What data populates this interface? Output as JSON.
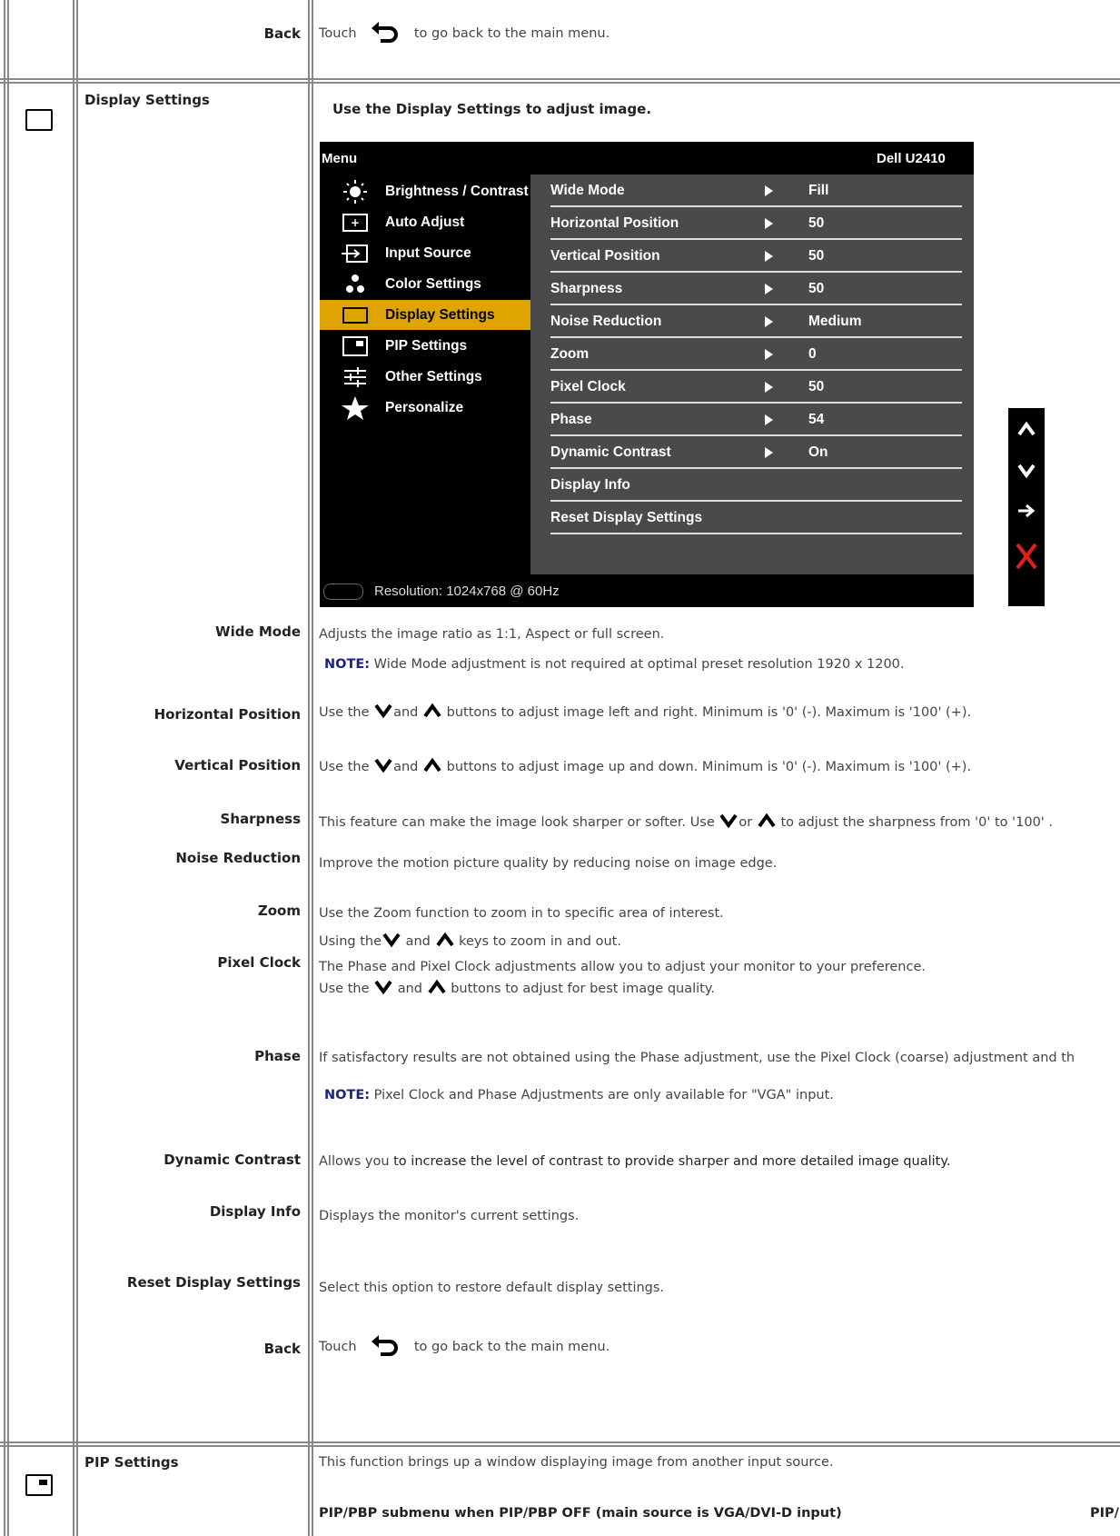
{
  "top": {
    "back_label": "Back",
    "back_pre": "Touch",
    "back_post": "to go back to the main menu."
  },
  "display": {
    "title": "Display Settings",
    "intro": "Use the Display Settings to adjust image.",
    "osd": {
      "menu_title": "Menu",
      "model": "Dell U2410",
      "main_items": [
        {
          "label": "Brightness / Contrast",
          "icon": "brightness-icon"
        },
        {
          "label": "Auto Adjust",
          "icon": "auto-adjust-icon"
        },
        {
          "label": "Input Source",
          "icon": "input-source-icon"
        },
        {
          "label": "Color Settings",
          "icon": "color-settings-icon"
        },
        {
          "label": "Display Settings",
          "icon": "display-settings-icon"
        },
        {
          "label": "PIP Settings",
          "icon": "pip-settings-icon"
        },
        {
          "label": "Other Settings",
          "icon": "other-settings-icon"
        },
        {
          "label": "Personalize",
          "icon": "star-icon"
        }
      ],
      "active_index": 4,
      "sub_items": [
        {
          "name": "Wide Mode",
          "value": "Fill"
        },
        {
          "name": "Horizontal Position",
          "value": "50"
        },
        {
          "name": "Vertical Position",
          "value": "50"
        },
        {
          "name": "Sharpness",
          "value": "50"
        },
        {
          "name": "Noise Reduction",
          "value": "Medium"
        },
        {
          "name": "Zoom",
          "value": "0"
        },
        {
          "name": "Pixel Clock",
          "value": "50"
        },
        {
          "name": "Phase",
          "value": "54"
        },
        {
          "name": "Dynamic Contrast",
          "value": "On"
        },
        {
          "name": "Display Info",
          "value": ""
        },
        {
          "name": "Reset Display Settings",
          "value": ""
        }
      ],
      "resolution": "Resolution: 1024x768 @ 60Hz",
      "accent_color": "#e0a400",
      "nav_icons": [
        "up-arrow-icon",
        "down-arrow-icon",
        "right-arrow-icon",
        "close-x-icon"
      ]
    },
    "rows": {
      "wide_mode": {
        "label": "Wide Mode",
        "text": "Adjusts the image ratio as 1:1, Aspect or full screen.",
        "note_label": "NOTE:",
        "note": " Wide Mode adjustment is not required at optimal preset resolution 1920 x 1200."
      },
      "hpos": {
        "label": "Horizontal Position",
        "pre": "Use the ",
        "mid": "and ",
        "post": " buttons to adjust image left and right. Minimum is '0' (-). Maximum is '100' (+)."
      },
      "vpos": {
        "label": "Vertical Position",
        "pre": "Use the ",
        "mid": "and ",
        "post": " buttons to adjust image up and down. Minimum is '0' (-). Maximum is '100' (+)."
      },
      "sharp": {
        "label": "Sharpness",
        "pre": "This feature can make the image look sharper or softer. Use ",
        "mid": "or ",
        "post": " to adjust the sharpness from '0' to '100' ."
      },
      "noise": {
        "label": "Noise Reduction",
        "text": "Improve the motion picture quality by reducing noise on image edge."
      },
      "zoom": {
        "label": "Zoom",
        "text": "Use the Zoom function to zoom in to specific area of interest.",
        "pre": "Using the",
        "mid": " and ",
        "post": " keys to zoom in and out."
      },
      "pixel": {
        "label": "Pixel Clock",
        "text": "The Phase and Pixel Clock adjustments allow you to adjust your monitor to your preference.",
        "pre": "Use the ",
        "mid": " and ",
        "post": " buttons to adjust for best image quality."
      },
      "phase": {
        "label": "Phase",
        "text": "If satisfactory results are not obtained using the Phase adjustment, use the Pixel Clock (coarse) adjustment and th",
        "note_label": "NOTE:",
        "note": " Pixel Clock and Phase Adjustments are only available for \"VGA\" input."
      },
      "dyn": {
        "label": "Dynamic Contrast",
        "pre": "Allows you ",
        "bold": "to increase the level of contrast to provide sharper and more detailed image quality."
      },
      "info": {
        "label": "Display Info",
        "text": "Displays the monitor's current settings."
      },
      "reset": {
        "label": "Reset Display Settings",
        "text": "Select this option to restore default display settings."
      },
      "back": {
        "label": "Back",
        "pre": "Touch",
        "post": "to go back to the main menu."
      }
    }
  },
  "pip": {
    "title": "PIP Settings",
    "text": "This function brings up a window displaying image from another input source.",
    "sub_pre": "PIP/PBP submenu when PIP/PBP OFF ",
    "sub_bold": "(main source is VGA/DVI-D input)",
    "sub_right": "PIP/"
  }
}
